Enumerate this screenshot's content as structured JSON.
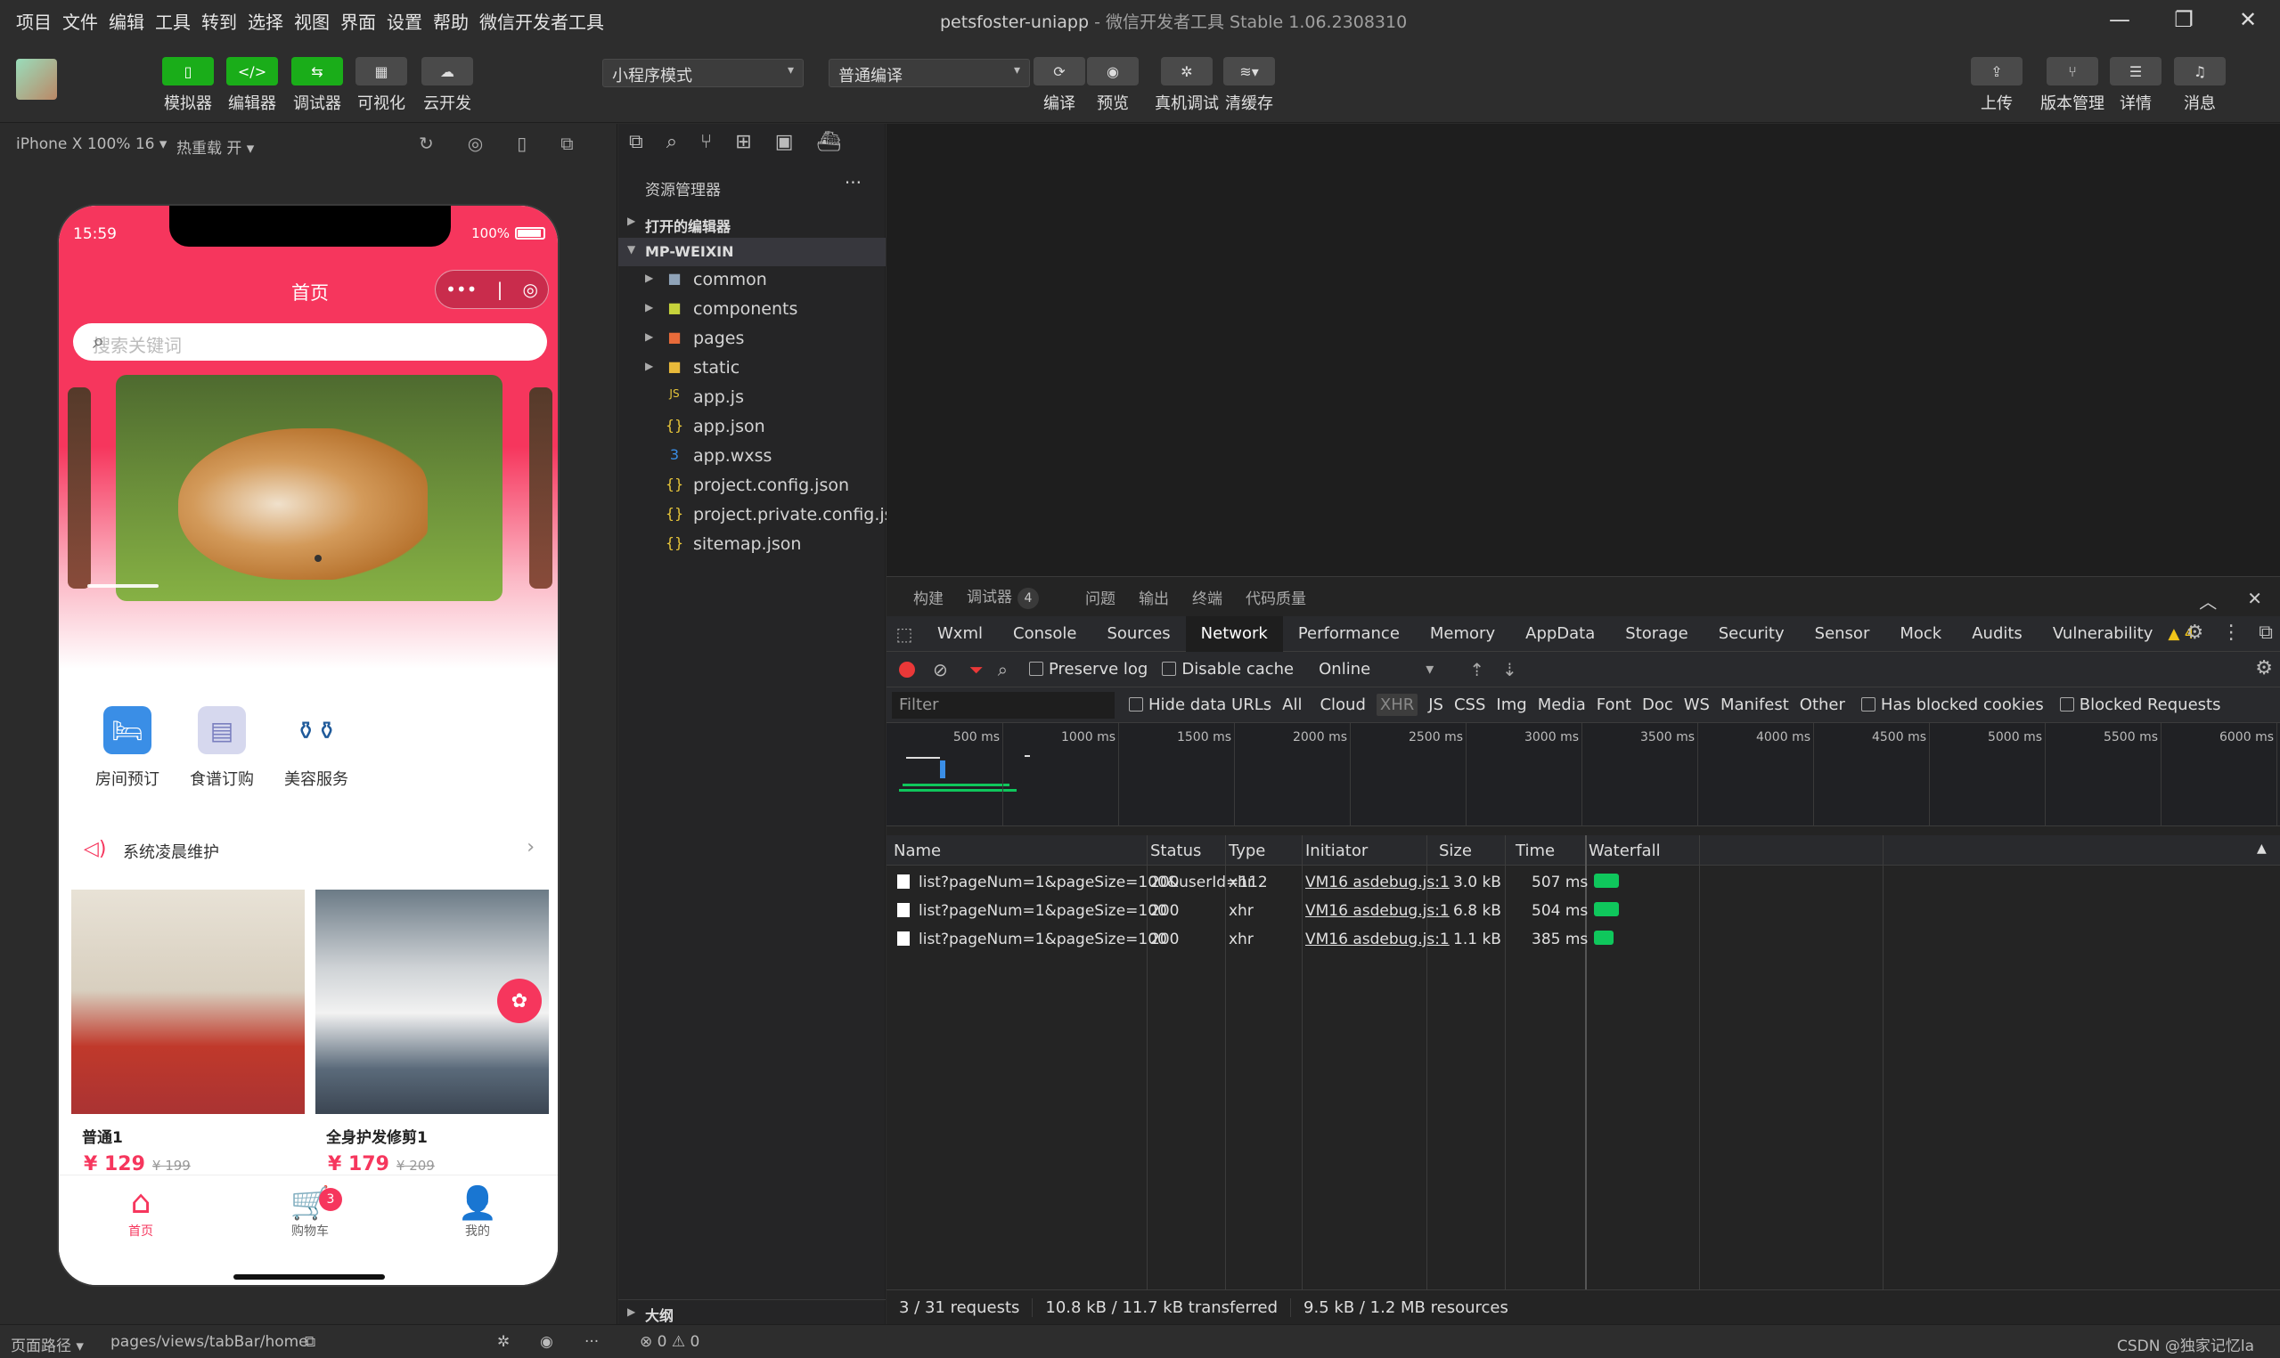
{
  "menu": [
    "项目",
    "文件",
    "编辑",
    "工具",
    "转到",
    "选择",
    "视图",
    "界面",
    "设置",
    "帮助",
    "微信开发者工具"
  ],
  "window": {
    "project": "petsfoster-uniapp",
    "app": "- 微信开发者工具 Stable 1.06.2308310"
  },
  "toolbar": {
    "simulator": "模拟器",
    "editor": "编辑器",
    "debugger": "调试器",
    "visual": "可视化",
    "cloud": "云开发",
    "mode_select": "小程序模式",
    "compile_select": "普通编译",
    "compile": "编译",
    "preview": "预览",
    "remote_debug": "真机调试",
    "clear_cache": "清缓存",
    "upload": "上传",
    "version": "版本管理",
    "details": "详情",
    "messages": "消息"
  },
  "simulator": {
    "device": "iPhone X 100% 16 ▾",
    "hot_reload": "热重载 开 ▾"
  },
  "phone": {
    "time": "15:59",
    "battery": "100%",
    "title": "首页",
    "search_placeholder": "搜索关键词",
    "categories": [
      {
        "label": "房间预订",
        "icon": "bed-icon",
        "color": "#3a8ee6"
      },
      {
        "label": "食谱订购",
        "icon": "menu-book-icon",
        "color": "#7a7fbf"
      },
      {
        "label": "美容服务",
        "icon": "bottles-icon",
        "color": "#1f5a9a"
      }
    ],
    "notice": "系统凌晨维护",
    "products": [
      {
        "name": "普通1",
        "price": "¥ 129",
        "orig": "¥ 199"
      },
      {
        "name": "全身护发修剪1",
        "price": "¥ 179",
        "orig": "¥ 209"
      }
    ],
    "tabs": [
      {
        "label": "首页"
      },
      {
        "label": "购物车",
        "badge": "3"
      },
      {
        "label": "我的"
      }
    ]
  },
  "explorer": {
    "title": "资源管理器",
    "open_editors": "打开的编辑器",
    "root": "MP-WEIXIN",
    "items": [
      {
        "name": "common",
        "kind": "folder",
        "color": "#8fa3b8"
      },
      {
        "name": "components",
        "kind": "folder",
        "color": "#c6d33b"
      },
      {
        "name": "pages",
        "kind": "folder",
        "color": "#e86b3a"
      },
      {
        "name": "static",
        "kind": "folder",
        "color": "#e8b93a"
      },
      {
        "name": "app.js",
        "kind": "file",
        "icon": "JS",
        "color": "#e8c63a"
      },
      {
        "name": "app.json",
        "kind": "file",
        "icon": "{}",
        "color": "#e8c63a"
      },
      {
        "name": "app.wxss",
        "kind": "file",
        "icon": "3",
        "color": "#3a8ee6"
      },
      {
        "name": "project.config.json",
        "kind": "file",
        "icon": "{}",
        "color": "#e8c63a"
      },
      {
        "name": "project.private.config.js...",
        "kind": "file",
        "icon": "{}",
        "color": "#e8c63a"
      },
      {
        "name": "sitemap.json",
        "kind": "file",
        "icon": "{}",
        "color": "#e8c63a"
      }
    ],
    "outline": "大纲"
  },
  "devtools": {
    "tabs": [
      "构建",
      "调试器",
      "问题",
      "输出",
      "终端",
      "代码质量"
    ],
    "debugger_count": "4",
    "panels": [
      "Wxml",
      "Console",
      "Sources",
      "Network",
      "Performance",
      "Memory",
      "AppData",
      "Storage",
      "Security",
      "Sensor",
      "Mock",
      "Audits",
      "Vulnerability"
    ],
    "warnings": "▲ 4",
    "preserve_log": "Preserve log",
    "disable_cache": "Disable cache",
    "throttle": "Online",
    "filter_placeholder": "Filter",
    "hide_data_urls": "Hide data URLs",
    "types": [
      "All",
      "Cloud",
      "XHR",
      "JS",
      "CSS",
      "Img",
      "Media",
      "Font",
      "Doc",
      "WS",
      "Manifest",
      "Other"
    ],
    "blocked_cookies": "Has blocked cookies",
    "blocked_requests": "Blocked Requests",
    "ticks": [
      "500 ms",
      "1000 ms",
      "1500 ms",
      "2000 ms",
      "2500 ms",
      "3000 ms",
      "3500 ms",
      "4000 ms",
      "4500 ms",
      "5000 ms",
      "5500 ms",
      "6000 ms"
    ],
    "columns": [
      "Name",
      "Status",
      "Type",
      "Initiator",
      "Size",
      "Time",
      "Waterfall"
    ],
    "rows": [
      {
        "name": "list?pageNum=1&pageSize=100&userId=112",
        "status": "200",
        "type": "xhr",
        "initiator": "VM16 asdebug.js:1",
        "size": "3.0 kB",
        "time": "507 ms",
        "wf": 28
      },
      {
        "name": "list?pageNum=1&pageSize=100",
        "status": "200",
        "type": "xhr",
        "initiator": "VM16 asdebug.js:1",
        "size": "6.8 kB",
        "time": "504 ms",
        "wf": 28
      },
      {
        "name": "list?pageNum=1&pageSize=100",
        "status": "200",
        "type": "xhr",
        "initiator": "VM16 asdebug.js:1",
        "size": "1.1 kB",
        "time": "385 ms",
        "wf": 22
      }
    ],
    "summary": [
      "3 / 31 requests",
      "10.8 kB / 11.7 kB transferred",
      "9.5 kB / 1.2 MB resources"
    ]
  },
  "bottom": {
    "page_path_label": "页面路径 ▾",
    "page_path": "pages/views/tabBar/home",
    "errors": "⊗ 0 ⚠ 0",
    "watermark": "CSDN @独家记忆la"
  }
}
